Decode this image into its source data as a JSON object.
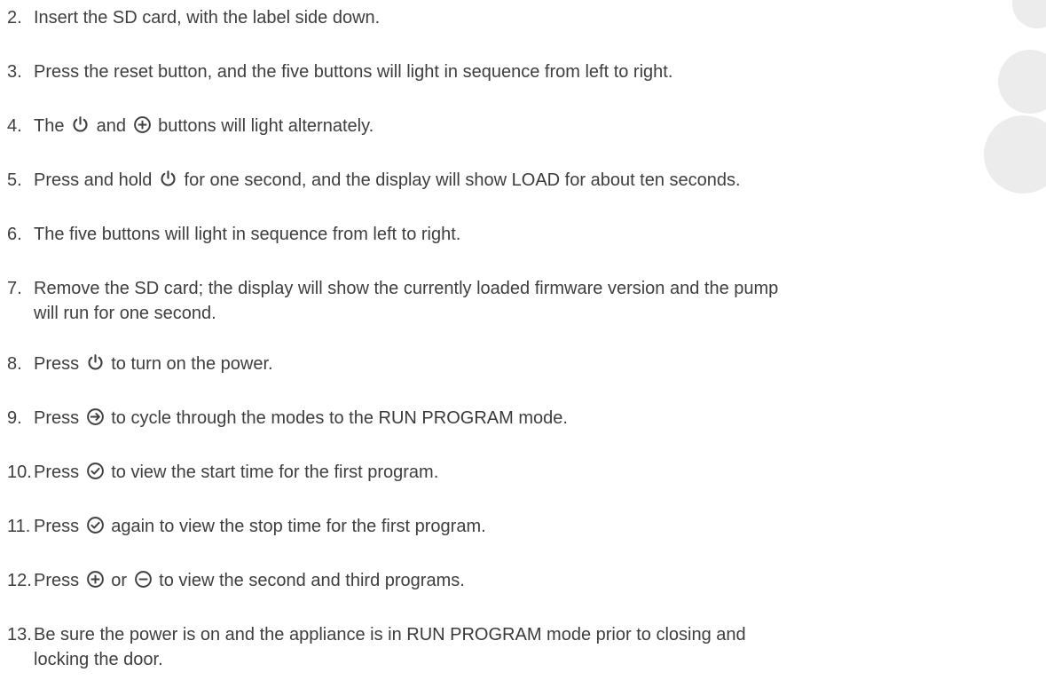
{
  "steps": [
    {
      "num": "2.",
      "parts": [
        {
          "t": "text",
          "v": "Insert the SD card, with the label side down."
        }
      ]
    },
    {
      "num": "3.",
      "parts": [
        {
          "t": "text",
          "v": "Press the reset button, and the five buttons will light in sequence from left to right."
        }
      ]
    },
    {
      "num": "4.",
      "parts": [
        {
          "t": "text",
          "v": "The "
        },
        {
          "t": "icon",
          "v": "power-icon"
        },
        {
          "t": "text",
          "v": " and "
        },
        {
          "t": "icon",
          "v": "plus-circle-icon"
        },
        {
          "t": "text",
          "v": " buttons will light alternately."
        }
      ]
    },
    {
      "num": "5.",
      "parts": [
        {
          "t": "text",
          "v": "Press and hold "
        },
        {
          "t": "icon",
          "v": "power-icon"
        },
        {
          "t": "text",
          "v": " for one second, and the display will show "
        },
        {
          "t": "bold",
          "v": "LOAD"
        },
        {
          "t": "text",
          "v": " for about ten seconds."
        }
      ]
    },
    {
      "num": "6.",
      "parts": [
        {
          "t": "text",
          "v": "The five buttons will light in sequence from left to right."
        }
      ]
    },
    {
      "num": "7.",
      "parts": [
        {
          "t": "text",
          "v": "Remove the SD card; the display will show the currently loaded firmware version and the pump"
        }
      ],
      "line2": "will run for one second."
    },
    {
      "num": "8.",
      "parts": [
        {
          "t": "text",
          "v": "Press "
        },
        {
          "t": "icon",
          "v": "power-icon"
        },
        {
          "t": "text",
          "v": " to turn on the power."
        }
      ]
    },
    {
      "num": "9.",
      "parts": [
        {
          "t": "text",
          "v": "Press "
        },
        {
          "t": "icon",
          "v": "arrow-right-circle-icon"
        },
        {
          "t": "text",
          "v": " to cycle through the modes to the "
        },
        {
          "t": "bold",
          "v": "RUN PROGRAM"
        },
        {
          "t": "text",
          "v": " mode."
        }
      ]
    },
    {
      "num": "10.",
      "parts": [
        {
          "t": "text",
          "v": "Press "
        },
        {
          "t": "icon",
          "v": "check-circle-icon"
        },
        {
          "t": "text",
          "v": " to view the start time for the first program."
        }
      ]
    },
    {
      "num": "11.",
      "parts": [
        {
          "t": "text",
          "v": "Press "
        },
        {
          "t": "icon",
          "v": "check-circle-icon"
        },
        {
          "t": "text",
          "v": " again to view the stop time for the first program."
        }
      ]
    },
    {
      "num": "12.",
      "parts": [
        {
          "t": "text",
          "v": "Press "
        },
        {
          "t": "icon",
          "v": "plus-circle-icon"
        },
        {
          "t": "text",
          "v": " or "
        },
        {
          "t": "icon",
          "v": "minus-circle-icon"
        },
        {
          "t": "text",
          "v": " to view the second and third programs."
        }
      ]
    },
    {
      "num": "13.",
      "parts": [
        {
          "t": "text",
          "v": "Be sure the power is on and the appliance is in "
        },
        {
          "t": "bold",
          "v": "RUN PROGRAM"
        },
        {
          "t": "text",
          "v": " mode prior to closing and"
        }
      ],
      "line2": "locking the door."
    }
  ],
  "colors": {
    "text": "#3e3e3e",
    "decor_dot": "#ececec"
  }
}
